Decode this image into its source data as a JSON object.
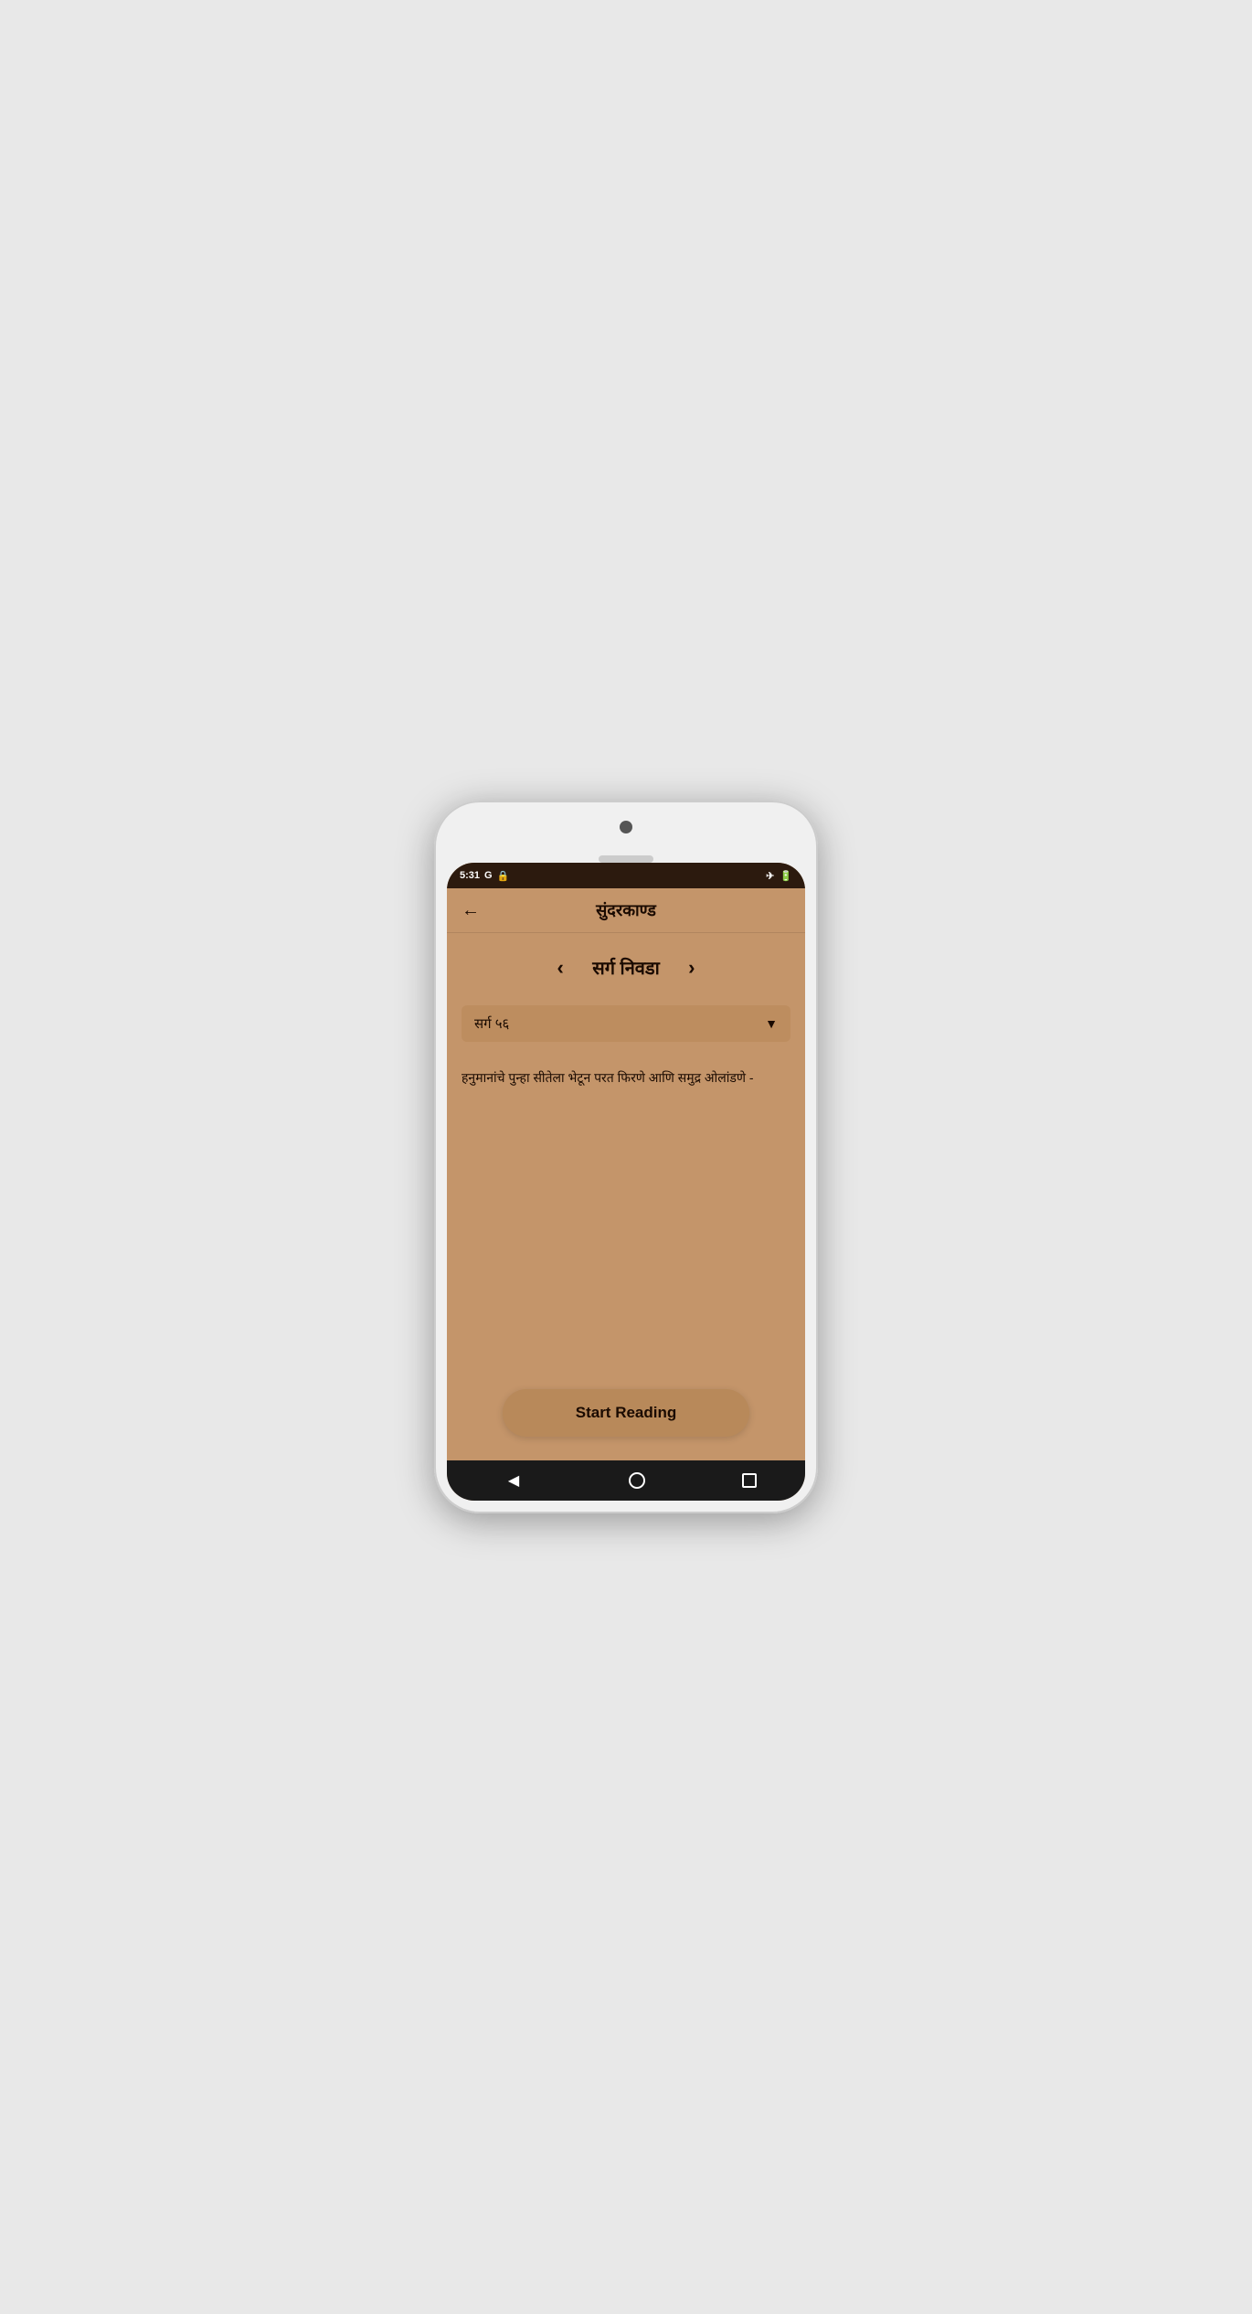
{
  "status_bar": {
    "time": "5:31",
    "icons_left": [
      "G",
      "🔒"
    ],
    "icons_right": [
      "✈",
      "🔋"
    ]
  },
  "header": {
    "back_label": "←",
    "title": "सुंदरकाण्ड"
  },
  "sarg_selector": {
    "title": "सर्ग निवडा",
    "prev_label": "‹",
    "next_label": "›"
  },
  "dropdown": {
    "value": "सर्ग ५६",
    "arrow": "▼"
  },
  "description": "हनुमानांचे पुन्हा सीतेला भेटून परत फिरणे आणि समुद्र ओलांडणे -",
  "start_reading_button": {
    "label": "Start Reading"
  },
  "bottom_nav": {
    "back_label": "◀",
    "home_label": "circle",
    "recent_label": "square"
  }
}
